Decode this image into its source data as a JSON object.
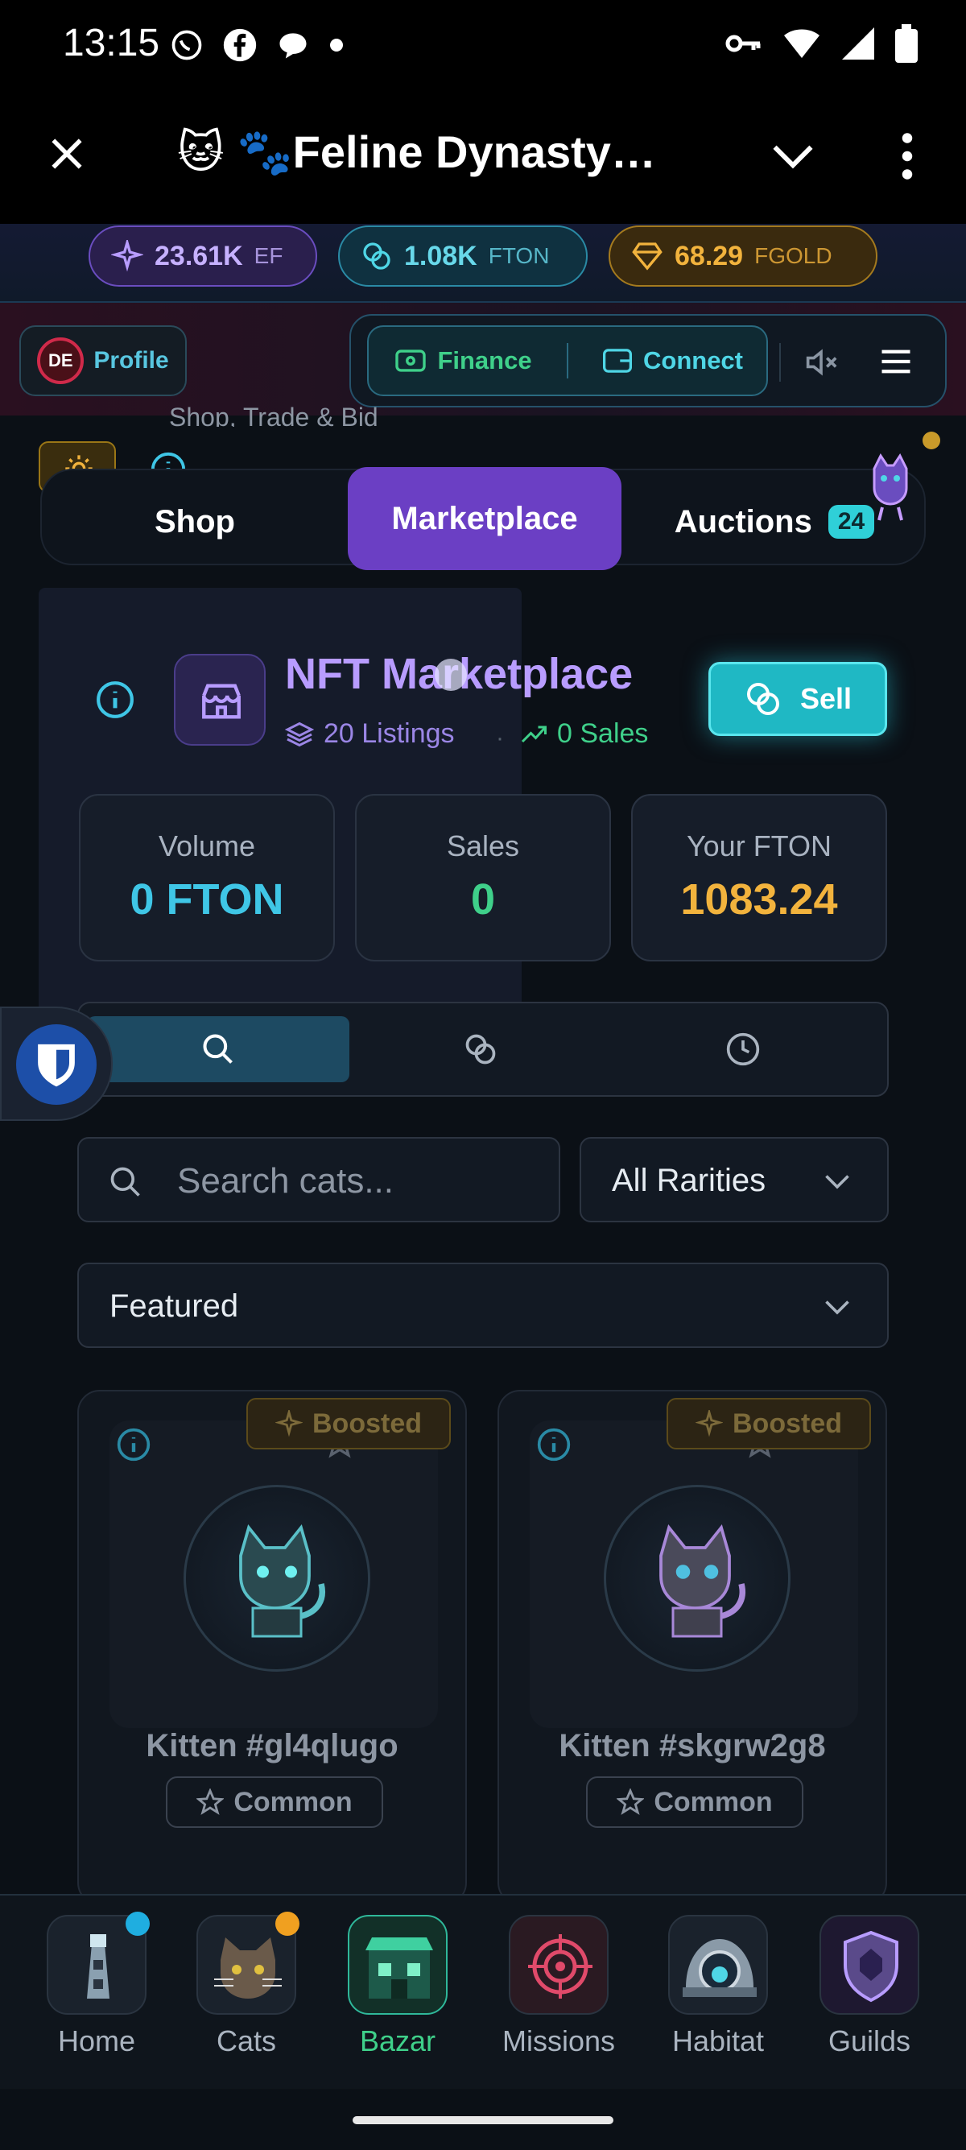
{
  "status_bar": {
    "time": "13:15",
    "icons": [
      "whatsapp-icon",
      "facebook-icon",
      "chat-icon",
      "dot-icon",
      "key-icon",
      "wifi-icon",
      "signal-icon",
      "battery-icon"
    ]
  },
  "browser": {
    "title": "🐱 🐾Feline Dynasty…"
  },
  "currencies": [
    {
      "value": "23.61K",
      "unit": "EF",
      "color": "#b89cff"
    },
    {
      "value": "1.08K",
      "unit": "FTON",
      "color": "#4fd6e6"
    },
    {
      "value": "68.29",
      "unit": "FGOLD",
      "color": "#f2b33d"
    }
  ],
  "header": {
    "avatar_initials": "DE",
    "profile_label": "Profile",
    "finance_label": "Finance",
    "connect_label": "Connect"
  },
  "tabs": {
    "subtitle": "Shop, Trade & Bid",
    "items": [
      {
        "label": "Shop"
      },
      {
        "label": "Marketplace"
      },
      {
        "label": "Auctions",
        "badge": "24"
      }
    ]
  },
  "marketplace": {
    "title": "NFT Marketplace",
    "listings": "20 Listings",
    "sales": "0 Sales",
    "sell_label": "Sell",
    "stats": [
      {
        "label": "Volume",
        "value": "0 FTON",
        "color": "#3fc6e6"
      },
      {
        "label": "Sales",
        "value": "0",
        "color": "#3fd08a"
      },
      {
        "label": "Your FTON",
        "value": "1083.24",
        "color": "#f2b33d"
      }
    ],
    "search_placeholder": "Search cats...",
    "rarity_filter": "All Rarities",
    "sort": "Featured"
  },
  "cards": [
    {
      "name": "Kitten #gl4qlugo",
      "rarity": "Common",
      "badge": "Boosted"
    },
    {
      "name": "Kitten #skgrw2g8",
      "rarity": "Common",
      "badge": "Boosted"
    }
  ],
  "bottom_nav": [
    {
      "label": "Home",
      "active": false
    },
    {
      "label": "Cats",
      "active": false
    },
    {
      "label": "Bazar",
      "active": true
    },
    {
      "label": "Missions",
      "active": false
    },
    {
      "label": "Habitat",
      "active": false
    },
    {
      "label": "Guilds",
      "active": false
    }
  ]
}
